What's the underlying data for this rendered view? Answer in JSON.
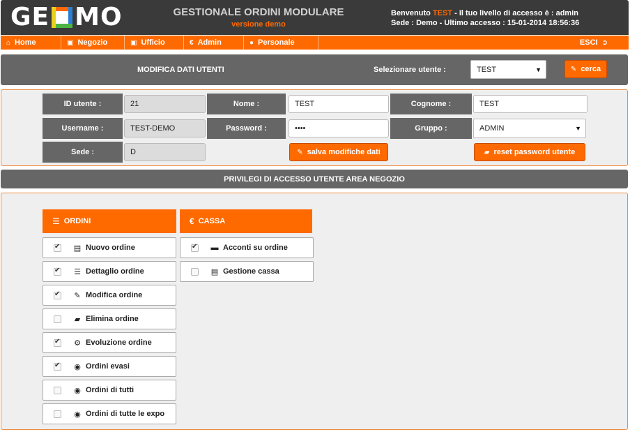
{
  "header": {
    "logo_left": "GE",
    "logo_right": "MO",
    "title": "GESTIONALE ORDINI MODULARE",
    "subtitle": "versione demo",
    "welcome_prefix": "Benvenuto",
    "welcome_user": "TEST",
    "welcome_suffix": "- Il tuo livello di accesso è : admin",
    "session_info": "Sede : Demo - Ultimo accesso : 15-01-2014 18:56:36"
  },
  "nav": {
    "items": [
      {
        "label": "Home",
        "icon": "home-icon"
      },
      {
        "label": "Negozio",
        "icon": "store-icon"
      },
      {
        "label": "Ufficio",
        "icon": "office-icon"
      },
      {
        "label": "Admin",
        "icon": "euro-icon"
      },
      {
        "label": "Personale",
        "icon": "user-icon"
      }
    ],
    "logout": "ESCI"
  },
  "user_bar": {
    "title": "MODIFICA DATI UTENTI",
    "select_label": "Selezionare utente :",
    "selected_user": "TEST",
    "search_button": "cerca"
  },
  "form": {
    "id_label": "ID utente :",
    "id_value": "21",
    "name_label": "Nome :",
    "name_value": "TEST",
    "surname_label": "Cognome :",
    "surname_value": "TEST",
    "username_label": "Username :",
    "username_value": "TEST-DEMO",
    "password_label": "Password :",
    "password_value": "••••",
    "group_label": "Gruppo :",
    "group_value": "ADMIN",
    "site_label": "Sede :",
    "site_value": "D",
    "save_button": "salva modifiche dati",
    "reset_button": "reset password utente"
  },
  "privileges": {
    "title": "PRIVILEGI DI ACCESSO UTENTE AREA NEGOZIO",
    "columns": [
      {
        "title": "ORDINI",
        "icon": "list-icon",
        "items": [
          {
            "label": "Nuovo ordine",
            "checked": true,
            "icon": "new-order-icon"
          },
          {
            "label": "Dettaglio ordine",
            "checked": true,
            "icon": "list-detail-icon"
          },
          {
            "label": "Modifica ordine",
            "checked": true,
            "icon": "edit-icon"
          },
          {
            "label": "Elimina ordine",
            "checked": false,
            "icon": "eraser-icon"
          },
          {
            "label": "Evoluzione ordine",
            "checked": true,
            "icon": "gears-icon"
          },
          {
            "label": "Ordini evasi",
            "checked": true,
            "icon": "eye-icon"
          },
          {
            "label": "Ordini di tutti",
            "checked": false,
            "icon": "eye-icon"
          },
          {
            "label": "Ordini di tutte le expo",
            "checked": false,
            "icon": "eye-icon"
          }
        ]
      },
      {
        "title": "CASSA",
        "icon": "euro-icon",
        "items": [
          {
            "label": "Acconti su ordine",
            "checked": true,
            "icon": "credit-card-icon"
          },
          {
            "label": "Gestione cassa",
            "checked": false,
            "icon": "cash-register-icon"
          }
        ]
      }
    ]
  },
  "colors": {
    "accent": "#ff6a00",
    "header_bg": "#3a3a3a",
    "bar_bg": "#666666",
    "panel_bg": "#efefef"
  }
}
